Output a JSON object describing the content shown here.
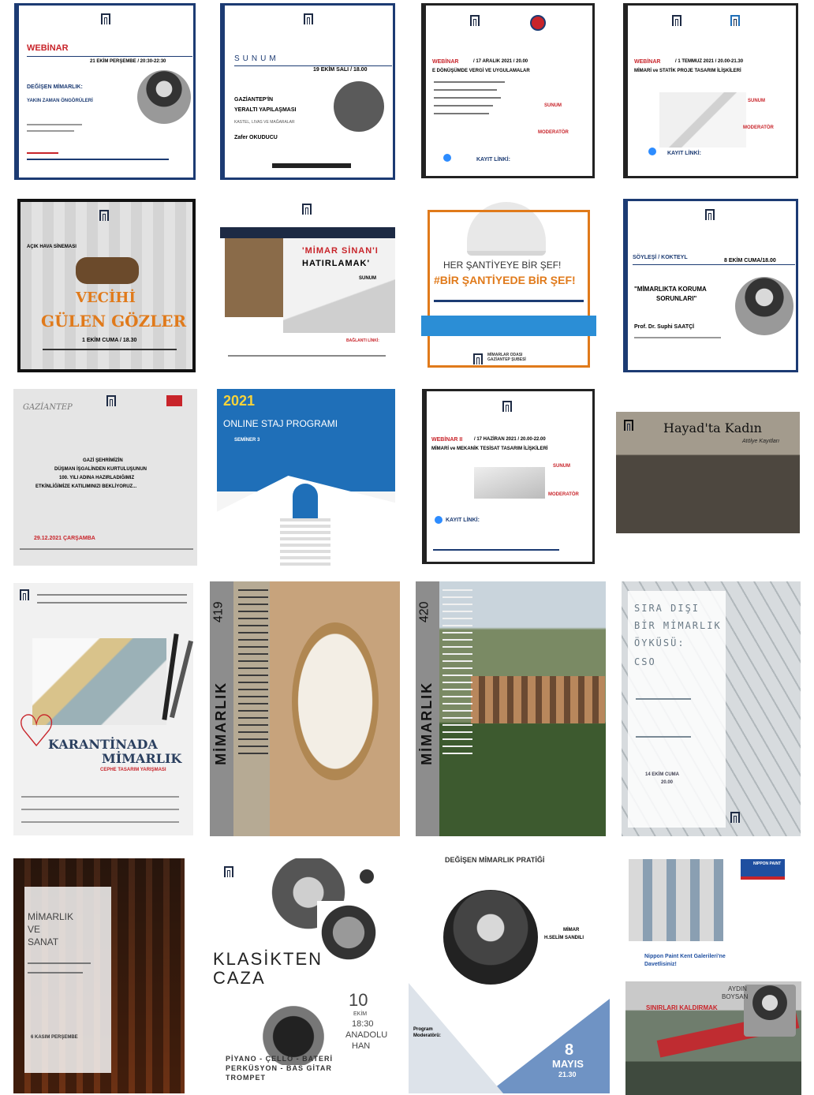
{
  "tiles": {
    "t1": {
      "type": "WEBİNAR",
      "date": "21 EKİM PERŞEMBE / 20:30-22:30",
      "title1": "DEĞİŞEN MİMARLIK:",
      "title2": "YAKIN ZAMAN ÖNGÖRÜLERİ"
    },
    "t2": {
      "type": "SUNUM",
      "date": "19 EKİM SALI / 18.00",
      "title1": "GAZİANTEP'İN",
      "title2": "YERALTI YAPILAŞMASI",
      "sub": "KASTEL, LIVAS VE MAĞARALAR",
      "speaker": "Zafer OKUDUCU"
    },
    "t3": {
      "type": "WEBİNAR",
      "date": "/ 17 ARALIK 2021 / 20.00",
      "title": "E DÖNÜŞÜMDE VERGİ VE UYGULAMALAR",
      "sunum": "SUNUM",
      "moderator": "MODERATÖR",
      "kayit": "KAYIT LİNKİ:"
    },
    "t4": {
      "type": "WEBİNAR",
      "date": "/ 1 TEMMUZ 2021 / 20.00-21.30",
      "title": "MİMARİ ve STATİK PROJE TASARIM İLİŞKİLERİ",
      "sunum": "SUNUM",
      "moderator": "MODERATÖR",
      "kayit": "KAYIT LİNKİ:"
    },
    "t5": {
      "type": "AÇIK HAVA SİNEMASI",
      "title1": "VECİHİ",
      "title2": "GÜLEN GÖZLER",
      "date": "1 EKİM CUMA / 18.30"
    },
    "t6": {
      "title1": "'MİMAR SİNAN'I",
      "title2": "HATIRLAMAK'",
      "sunum": "SUNUM",
      "link": "BAĞLANTI LİNKİ:"
    },
    "t7": {
      "line1": "HER ŞANTİYEYE BİR ŞEF!",
      "line2": "#BİR ŞANTİYEDE BİR ŞEF!",
      "footer": "MİMARLAR ODASI GAZİANTEP ŞUBESİ"
    },
    "t8": {
      "type": "SÖYLEŞİ / KOKTEYL",
      "date": "8 EKİM CUMA/18.00",
      "title1": "\"MİMARLIKTA KORUMA",
      "title2": "SORUNLARI\"",
      "speaker": "Prof. Dr. Suphi SAATÇİ"
    },
    "t9": {
      "city": "GAZİANTEP",
      "l1": "GAZİ ŞEHRİMİZİN",
      "l2": "DÜŞMAN İŞGALİNDEN KURTULUŞUNUN",
      "l3": "100. YILI ADINA HAZIRLADIĞIMIZ",
      "l4": "ETKİNLİĞİMİZE KATILIMINIZI BEKLİYORUZ...",
      "date": "29.12.2021 ÇARŞAMBA"
    },
    "t10": {
      "year": "2021",
      "title": "ONLINE STAJ PROGRAMI",
      "sub": "SEMİNER 3"
    },
    "t11": {
      "type": "WEBİNAR II",
      "date": "/ 17 HAZİRAN 2021 / 20.00-22.00",
      "title": "MİMARİ ve MEKANİK TESİSAT TASARIM İLİŞKİLERİ",
      "sunum": "SUNUM",
      "moderator": "MODERATÖR",
      "kayit": "KAYIT LİNKİ:"
    },
    "t12": {
      "title": "Hayad'ta Kadın",
      "sub": "Atölye Kayıtları"
    },
    "t13": {
      "title1": "KARANTİNADA",
      "title2": "MİMARLIK",
      "sub": "CEPHE TASARIM YARIŞMASI"
    },
    "t14": {
      "title": "MİMARLIK",
      "issue": "419"
    },
    "t15": {
      "title": "MİMARLIK",
      "issue": "420"
    },
    "t16": {
      "l1": "SIRA DIŞI",
      "l2": "BİR MİMARLIK",
      "l3": "ÖYKÜSÜ:",
      "l4": "CSO",
      "date": "14 EKİM CUMA",
      "time": "20.00"
    },
    "t17": {
      "l1": "MİMARLIK",
      "l2": "VE",
      "l3": "SANAT",
      "date": "6 KASIM PERŞEMBE"
    },
    "t18": {
      "title1": "KLASİKTEN",
      "title2": "CAZA",
      "day": "10",
      "month": "EKİM",
      "time": "18:30",
      "place1": "ANADOLU",
      "place2": "HAN",
      "instr1": "PİYANO - ÇELLO - BATERİ",
      "instr2": "PERKÜSYON - BAS GİTAR",
      "instr3": "TROMPET"
    },
    "t19": {
      "title": "DEĞİŞEN MİMARLIK PRATİĞİ",
      "speaker1": "MİMAR",
      "speaker2": "H.SELİM SANDILI",
      "program": "Program",
      "moderator": "Moderatörü:",
      "date1": "8",
      "date2": "MAYIS",
      "time": "21.30"
    },
    "t20": {
      "text1": "Nippon Paint Kent Galerileri'ne",
      "text2": "Davetlisiniz!",
      "brand": "NIPPON PAINT"
    },
    "t21": {
      "name1": "AYDIN",
      "name2": "BOYSAN",
      "title": "SINIRLARI KALDIRMAK"
    }
  },
  "colors": {
    "navy": "#1c3b73",
    "red": "#c8242a",
    "blue": "#1f6fb8",
    "orange": "#e07a1b"
  }
}
